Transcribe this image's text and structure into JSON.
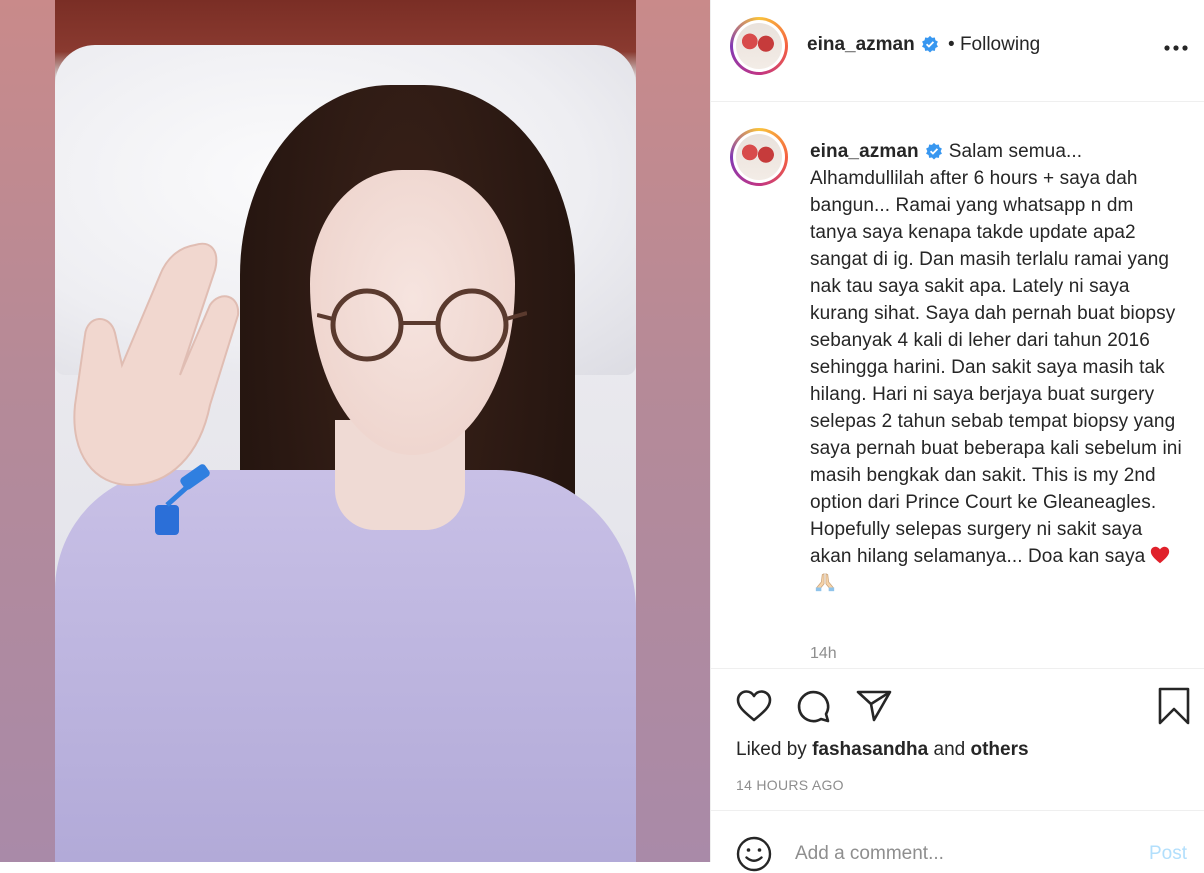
{
  "post": {
    "username": "eina_azman",
    "follow_status": "• Following",
    "caption": "Salam semua... Alhamdullilah after 6 hours + saya dah bangun... Ramai yang whatsapp n dm tanya saya kenapa takde update apa2 sangat di ig. Dan masih terlalu ramai yang nak tau saya sakit apa. Lately ni saya kurang sihat. Saya dah pernah buat biopsy sebanyak 4 kali di leher dari tahun 2016 sehingga harini. Dan sakit saya masih tak hilang. Hari ni saya berjaya buat surgery selepas 2 tahun sebab tempat biopsy yang saya pernah buat beberapa kali sebelum ini masih bengkak dan sakit. This is my 2nd option dari Prince Court ke Gleaneagles. Hopefully selepas surgery ni sakit saya akan hilang selamanya... Doa kan saya",
    "caption_emojis": [
      "red-heart",
      "folded-hands"
    ],
    "caption_age": "14h",
    "liked_by_prefix": "Liked by",
    "liked_by_user": "fashasandha",
    "liked_by_and": "and",
    "liked_by_others": "others",
    "posted_ago": "14 HOURS AGO"
  },
  "comment": {
    "placeholder": "Add a comment...",
    "post_label": "Post"
  },
  "icons": {
    "verified": "verified-badge-icon",
    "more": "more-options-icon",
    "like": "heart-icon",
    "comment": "comment-icon",
    "share": "paper-plane-icon",
    "save": "bookmark-icon",
    "emoji": "smiley-icon"
  },
  "colors": {
    "verified_blue": "#3897f0",
    "post_button": "#b2dffc",
    "secondary_text": "#8e8e8e"
  }
}
